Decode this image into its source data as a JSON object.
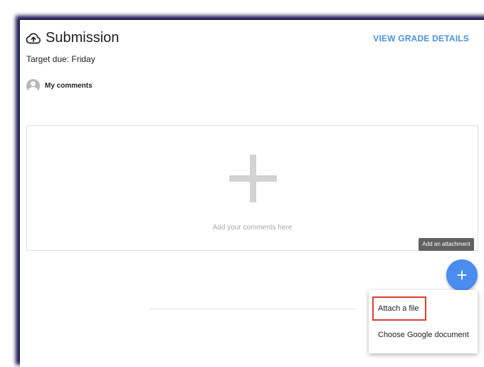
{
  "submission": {
    "title": "Submission",
    "view_grade_label": "VIEW GRADE DETAILS",
    "due_text": "Target due: Friday"
  },
  "comments": {
    "label": "My comments",
    "placeholder": "Add your comments here"
  },
  "attachment": {
    "tooltip": "Add an attachment",
    "fab_glyph": "+",
    "menu_items": [
      {
        "label": "Attach a file",
        "highlighted": true
      },
      {
        "label": "Choose Google document",
        "highlighted": false
      }
    ]
  },
  "colors": {
    "accent": "#4a90d9",
    "fab": "#4a8cf0",
    "highlight": "#e03c31",
    "frame": "#1c1654"
  },
  "icons": {
    "title_icon": "cloud-upload-icon",
    "avatar_icon": "person-avatar-icon"
  }
}
